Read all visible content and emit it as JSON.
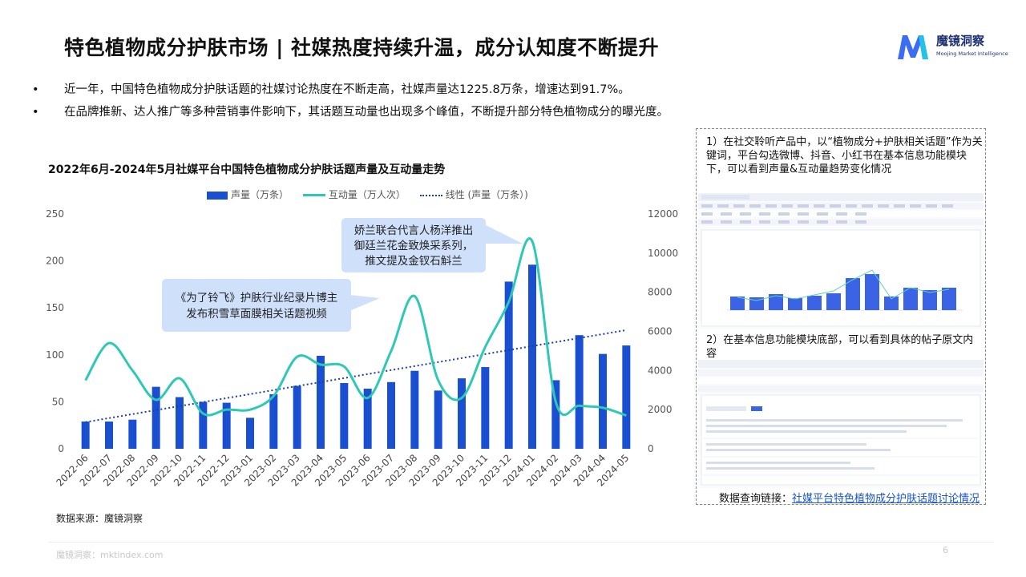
{
  "header": {
    "title": "特色植物成分护肤市场 | 社媒热度持续升温，成分认知度不断提升",
    "logo_name": "魔镜洞察",
    "logo_sub": "Moojing Market Intelligence"
  },
  "bullets": [
    "近一年，中国特色植物成分护肤话题的社媒讨论热度在不断走高，社媒声量达1225.8万条，增速达到91.7%。",
    "在品牌推新、达人推广等多种营销事件影响下，其话题互动量也出现多个峰值，不断提升部分特色植物成分的曝光度。"
  ],
  "bullet_symbol": "•",
  "chart_data": {
    "type": "bar",
    "title": "2022年6月-2024年5月社媒平台中国特色植物成分护肤话题声量及互动量走势",
    "categories": [
      "2022-06",
      "2022-07",
      "2022-08",
      "2022-09",
      "2022-10",
      "2022-11",
      "2022-12",
      "2023-01",
      "2023-02",
      "2023-03",
      "2023-04",
      "2023-05",
      "2023-06",
      "2023-07",
      "2023-08",
      "2023-09",
      "2023-10",
      "2023-11",
      "2023-12",
      "2024-01",
      "2024-02",
      "2024-03",
      "2024-04",
      "2024-05"
    ],
    "series": [
      {
        "name": "声量（万条）",
        "type": "bar",
        "axis": "left",
        "color": "#1a4fd1",
        "values": [
          29,
          29,
          31,
          66,
          55,
          50,
          49,
          33,
          58,
          67,
          99,
          70,
          64,
          71,
          83,
          62,
          75,
          87,
          178,
          196,
          73,
          121,
          101,
          110
        ]
      },
      {
        "name": "互动量（万人次）",
        "type": "line",
        "axis": "right",
        "color": "#2ec9b4",
        "values": [
          3500,
          5400,
          4000,
          2500,
          3600,
          1800,
          2000,
          2000,
          2700,
          4700,
          4300,
          4200,
          2600,
          5000,
          7800,
          3500,
          2600,
          5200,
          7500,
          10600,
          2400,
          2200,
          2100,
          1700
        ]
      },
      {
        "name": "线性 (声量（万条）)",
        "type": "trendline",
        "axis": "left",
        "color": "#1a3fa8"
      }
    ],
    "y_left": {
      "min": 0,
      "max": 250,
      "ticks": [
        0,
        50,
        100,
        150,
        200,
        250
      ]
    },
    "y_right": {
      "min": 0,
      "max": 12000,
      "ticks": [
        0,
        2000,
        4000,
        6000,
        8000,
        10000,
        12000
      ]
    },
    "grid": false,
    "legend": "top-center",
    "annotations": [
      {
        "text": [
          "《为了铃飞》护肤行业纪录片博主",
          "发布积雪草面膜相关话题视频"
        ],
        "points_to": "2022-12"
      },
      {
        "text": [
          "娇兰联合代言人杨洋推出",
          "御廷兰花金致焕采系列，",
          "推文提及金钗石斛兰"
        ],
        "points_to": "2024-01"
      }
    ]
  },
  "source": "数据来源：魔镜洞察",
  "footer": {
    "text": "魔镜洞察：mktindex.com",
    "page": "6"
  },
  "panel": {
    "text1": "1）在社交聆听产品中，以“植物成分+护肤相关话题”作为关键词，平台勾选微博、抖音、小红书在基本信息功能模块下，可以看到声量&互动量趋势变化情况",
    "text2": "2）在基本信息功能模块底部，可以看到具体的帖子原文内容",
    "link_label": "数据查询链接：",
    "link_text": "社媒平台特色植物成分护肤话题讨论情况"
  },
  "colors": {
    "bar": "#1a4fd1",
    "line": "#2ec9b4",
    "trend": "#1a3fa8",
    "callout": "#cfe0fb",
    "logo": "#3a6cf4"
  }
}
